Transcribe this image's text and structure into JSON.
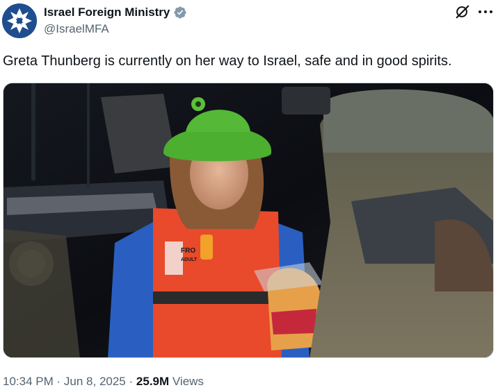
{
  "author": {
    "display_name": "Israel Foreign Ministry",
    "handle": "@IsraelMFA",
    "verified_badge_color": "#829aab"
  },
  "icons": {
    "grok": "grok-icon",
    "more": "more-icon",
    "verified": "verified-badge-icon"
  },
  "tweet": {
    "text": "Greta Thunberg is currently on her way to Israel, safe and in good spirits."
  },
  "media": {
    "type": "photo",
    "printed_text": [
      "FRO",
      "ADULT"
    ]
  },
  "meta": {
    "time": "10:34 PM",
    "sep1": "·",
    "date": "Jun 8, 2025",
    "sep2": "·",
    "views_count": "25.9M",
    "views_label": "Views"
  },
  "colors": {
    "text_primary": "#0f1419",
    "text_secondary": "#536471",
    "avatar_bg": "#1f4e8f"
  }
}
